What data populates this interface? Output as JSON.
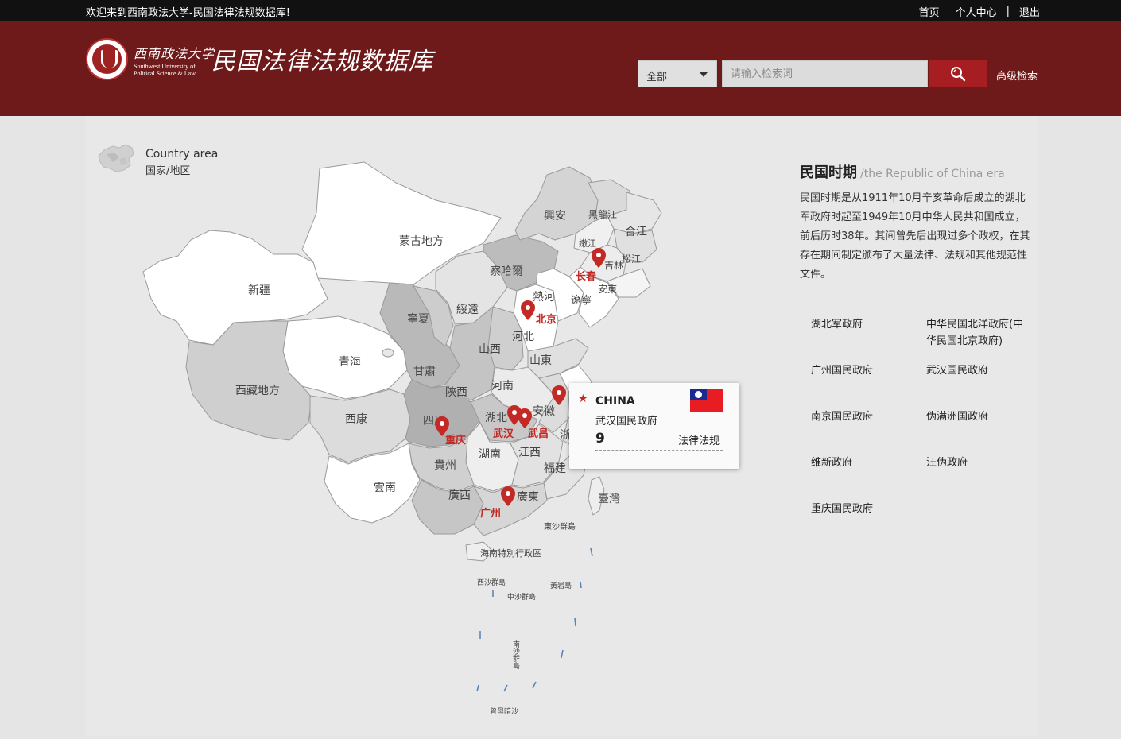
{
  "topbar": {
    "welcome": "欢迎来到西南政法大学-民国法律法规数据库!",
    "home": "首页",
    "user_center": "个人中心",
    "separator": "|",
    "logout": "退出"
  },
  "header": {
    "logo_cn": "西南政法大学",
    "logo_en_line1": "Southwest University of",
    "logo_en_line2": "Political Science & Law",
    "db_title": "民国法律法规数据库",
    "search_scope": "全部",
    "search_placeholder": "请输入检索词",
    "advanced_search": "高级检索"
  },
  "country_area": {
    "en": "Country area",
    "cn": "国家/地区"
  },
  "map": {
    "provinces": [
      "蒙古地方",
      "新疆",
      "青海",
      "西藏地方",
      "西康",
      "甘肅",
      "寧夏",
      "綏遠",
      "察哈爾",
      "熱河",
      "興安",
      "黑龍江",
      "嫩江",
      "合江",
      "松江",
      "吉林",
      "安東",
      "遼寧",
      "河北",
      "山西",
      "山東",
      "陝西",
      "河南",
      "四川",
      "湖北",
      "安徽",
      "湖南",
      "江西",
      "貴州",
      "雲南",
      "廣西",
      "廣東",
      "福建",
      "臺灣",
      "浙江",
      "東沙群島",
      "海南特別行政區",
      "西沙群島",
      "中沙群島",
      "黃岩島",
      "南沙群島",
      "曾母暗沙"
    ],
    "cities": [
      "长春",
      "北京",
      "重庆",
      "武汉",
      "武昌",
      "广州"
    ]
  },
  "popup": {
    "country": "CHINA",
    "government": "武汉国民政府",
    "count": "9",
    "unit": "法律法规"
  },
  "info": {
    "title": "民国时期",
    "title_en": "/the Republic of China era",
    "description": "民国时期是从1911年10月辛亥革命后成立的湖北军政府时起至1949年10月中华人民共和国成立，前后历时38年。其间曾先后出现过多个政权，在其存在期间制定颁布了大量法律、法规和其他规范性文件。",
    "governments": [
      "湖北军政府",
      "中华民国北洋政府(中华民国北京政府)",
      "广州国民政府",
      "武汉国民政府",
      "南京国民政府",
      "伪满洲国政府",
      "维新政府",
      "汪伪政府",
      "重庆国民政府"
    ]
  },
  "colors": {
    "header_bg": "#6e1a1a",
    "accent": "#a61e22",
    "marker": "#c32a25"
  }
}
